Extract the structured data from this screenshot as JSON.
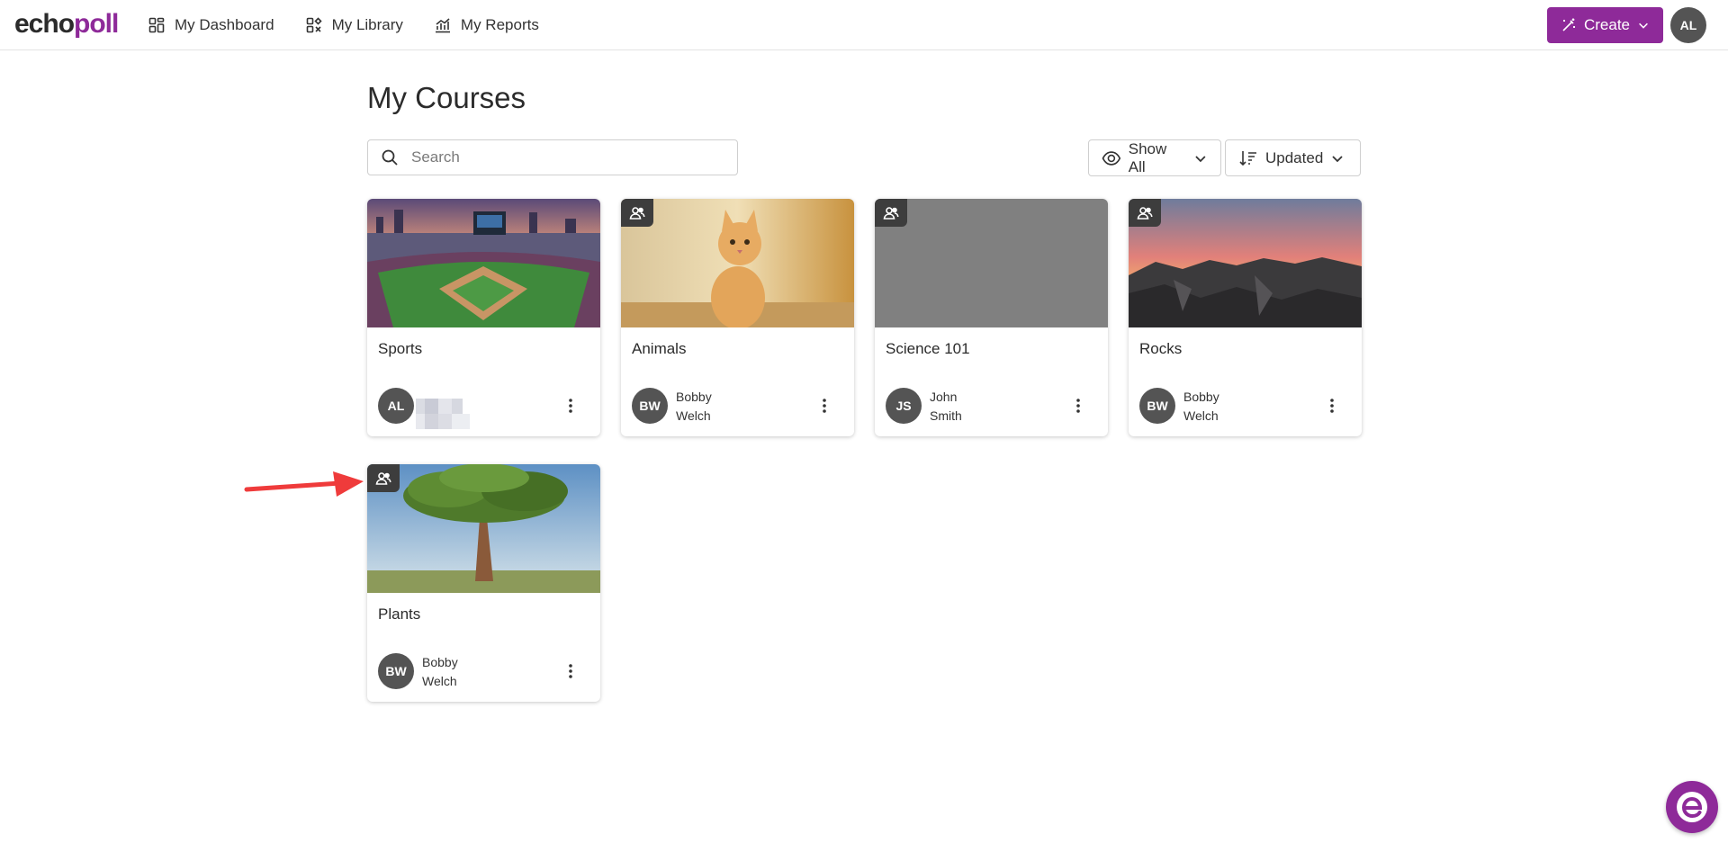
{
  "header": {
    "logo_part1": "echo",
    "logo_part2": "poll",
    "nav": [
      {
        "label": "My Dashboard",
        "icon": "dashboard-icon"
      },
      {
        "label": "My Library",
        "icon": "library-icon"
      },
      {
        "label": "My Reports",
        "icon": "reports-icon"
      }
    ],
    "create_label": "Create",
    "user_initials": "AL",
    "brand_color": "#8e2a99"
  },
  "main": {
    "title": "My Courses",
    "search_placeholder": "Search",
    "filter_label": "Show All",
    "sort_label": "Updated"
  },
  "courses": [
    {
      "title": "Sports",
      "owner_initials": "AL",
      "owner_first": "",
      "owner_last": "",
      "shared": false,
      "owner_blurred": true
    },
    {
      "title": "Animals",
      "owner_initials": "BW",
      "owner_first": "Bobby",
      "owner_last": "Welch",
      "shared": true
    },
    {
      "title": "Science 101",
      "owner_initials": "JS",
      "owner_first": "John",
      "owner_last": "Smith",
      "shared": true
    },
    {
      "title": "Rocks",
      "owner_initials": "BW",
      "owner_first": "Bobby",
      "owner_last": "Welch",
      "shared": true
    },
    {
      "title": "Plants",
      "owner_initials": "BW",
      "owner_first": "Bobby",
      "owner_last": "Welch",
      "shared": true
    }
  ],
  "colors": {
    "avatar_bg": "#545454",
    "badge_bg": "#3d3d3d",
    "annotation_arrow": "#ef3b3b"
  }
}
